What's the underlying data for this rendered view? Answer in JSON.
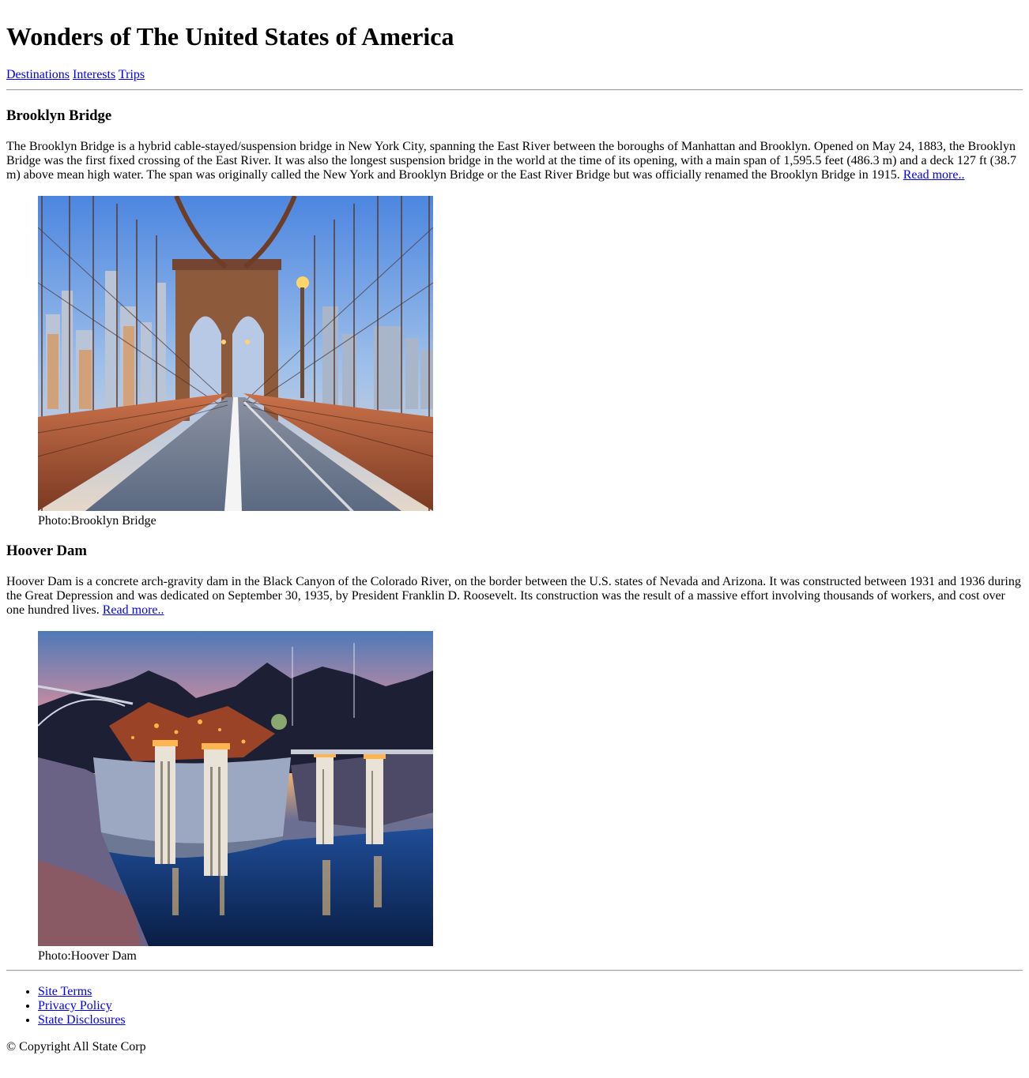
{
  "page": {
    "title": "Wonders of The United States of America"
  },
  "nav": {
    "items": [
      {
        "label": "Destinations"
      },
      {
        "label": "Interests"
      },
      {
        "label": "Trips"
      }
    ]
  },
  "articles": [
    {
      "heading": "Brooklyn Bridge",
      "body": "The Brooklyn Bridge is a hybrid cable-stayed/suspension bridge in New York City, spanning the East River between the boroughs of Manhattan and Brooklyn. Opened on May 24, 1883, the Brooklyn Bridge was the first fixed crossing of the East River. It was also the longest suspension bridge in the world at the time of its opening, with a main span of 1,595.5 feet (486.3 m) and a deck 127 ft (38.7 m) above mean high water. The span was originally called the New York and Brooklyn Bridge or the East River Bridge but was officially renamed the Brooklyn Bridge in 1915.",
      "read_more": "Read more..",
      "caption": "Photo:Brooklyn Bridge"
    },
    {
      "heading": "Hoover Dam",
      "body": "Hoover Dam is a concrete arch-gravity dam in the Black Canyon of the Colorado River, on the border between the U.S. states of Nevada and Arizona. It was constructed between 1931 and 1936 during the Great Depression and was dedicated on September 30, 1935, by President Franklin D. Roosevelt. Its construction was the result of a massive effort involving thousands of workers, and cost over one hundred lives.",
      "read_more": "Read more..",
      "caption": "Photo:Hoover Dam"
    }
  ],
  "footer": {
    "links": [
      {
        "label": "Site Terms"
      },
      {
        "label": "Privacy Policy"
      },
      {
        "label": "State Disclosures"
      }
    ],
    "copyright": "© Copyright All State Corp"
  }
}
